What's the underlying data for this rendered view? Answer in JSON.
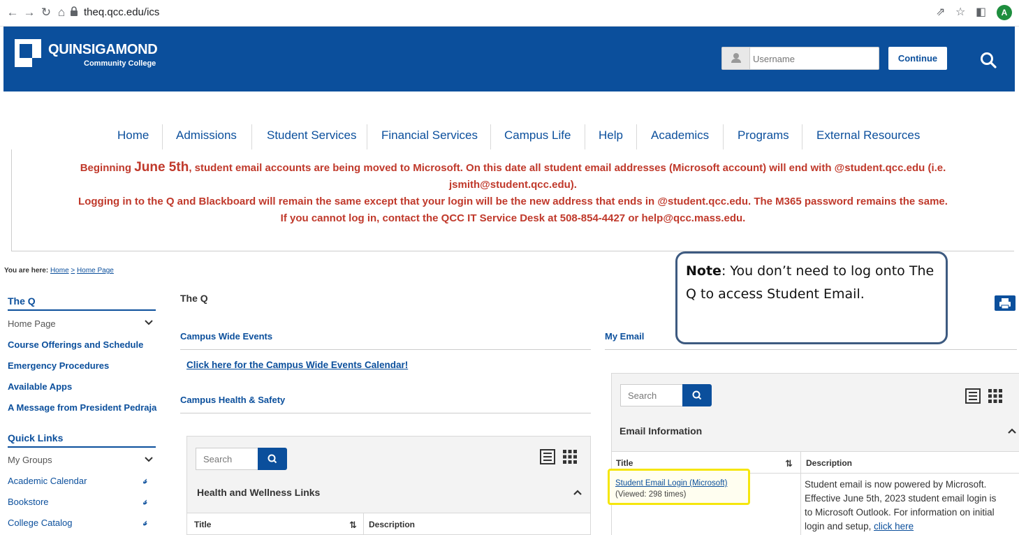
{
  "browser": {
    "url": "theq.qcc.edu/ics",
    "avatar_letter": "A"
  },
  "header": {
    "brand_name": "QUINSIGAMOND",
    "brand_sub": "Community College",
    "username_placeholder": "Username",
    "continue_label": "Continue"
  },
  "nav": [
    "Home",
    "Admissions",
    "Student Services",
    "Financial Services",
    "Campus Life",
    "Help",
    "Academics",
    "Programs",
    "External Resources"
  ],
  "announcement": {
    "line1_pre": "Beginning ",
    "line1_date": "June 5th",
    "line1_post": ", student email accounts are being moved to Microsoft. On this date all student email addresses (Microsoft account) will end with @student.qcc.edu (i.e.",
    "line2": "jsmith@student.qcc.edu).",
    "line3": "Logging in to the Q and Blackboard will remain the same except that your login will be the new address that ends in @student.qcc.edu. The M365 password remains the same.",
    "line4": "If you cannot log in, contact the QCC IT Service Desk at 508-854-4427 or help@qcc.mass.edu."
  },
  "breadcrumb": {
    "prefix": "You are here:",
    "home": "Home",
    "sep": ">",
    "page": "Home Page"
  },
  "sidebar": {
    "the_q_heading": "The Q",
    "the_q_items": [
      "Home Page",
      "Course Offerings and Schedule",
      "Emergency Procedures",
      "Available Apps",
      "A Message from President Pedraja"
    ],
    "quick_links_heading": "Quick Links",
    "quick_links_items": [
      "My Groups",
      "Academic Calendar",
      "Bookstore",
      "College Catalog"
    ]
  },
  "main": {
    "title": "The Q",
    "campus_events_title": "Campus Wide Events",
    "campus_events_link": "Click here for the Campus Wide Events Calendar!",
    "health_title": "Campus Health & Safety",
    "health_panel": {
      "search_placeholder": "Search",
      "section_title": "Health and Wellness Links",
      "col_title": "Title",
      "col_desc": "Description"
    }
  },
  "email": {
    "title": "My Email",
    "panel": {
      "search_placeholder": "Search",
      "section_title": "Email Information",
      "col_title": "Title",
      "col_desc": "Description",
      "row_link": "Student Email Login (Microsoft)",
      "row_views": "(Viewed: 298 times)",
      "row_desc_l1": "Student email is now powered by Microsoft.",
      "row_desc_l2": "Effective June 5th, 2023 student email login is",
      "row_desc_l3": "to Microsoft Outlook. For information on initial",
      "row_desc_l4_pre": "login and setup, ",
      "row_desc_l4_link": "click here"
    }
  },
  "note": {
    "label": "Note",
    "text": ": You don’t need to log onto The Q to access Student Email."
  },
  "colors": {
    "brand_blue": "#0b4f9c",
    "alert_red": "#c0392b",
    "highlight_yellow": "#f5e60c"
  }
}
